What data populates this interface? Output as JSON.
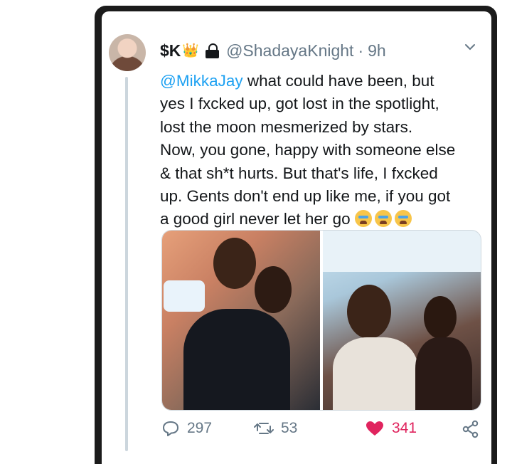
{
  "tweet": {
    "display_name": "$K",
    "crown_emoji": "👑",
    "handle": "@ShadayaKnight",
    "separator": "·",
    "time": "9h",
    "mention": "@MikkaJay",
    "text_lines": [
      " what could have been, but",
      "yes I fxcked up, got lost in the spotlight,",
      "lost the moon mesmerized by stars.",
      "Now, you gone, happy with someone else",
      "& that sh*t hurts. But that's life, I fxcked",
      "up. Gents don't end up like me, if you got",
      "a good girl never let her go"
    ],
    "emojis": [
      "loudly-crying-face",
      "loudly-crying-face",
      "loudly-crying-face"
    ],
    "media_count": 2
  },
  "actions": {
    "reply_count": "297",
    "retweet_count": "53",
    "like_count": "341",
    "like_color": "#e0245e"
  },
  "icons": [
    "chevron-down-icon",
    "lock-icon",
    "reply-icon",
    "retweet-icon",
    "heart-icon",
    "share-icon"
  ],
  "colors": {
    "link": "#1da1f2",
    "muted": "#657786",
    "text": "#14171a",
    "frame": "#1b1b1b"
  }
}
